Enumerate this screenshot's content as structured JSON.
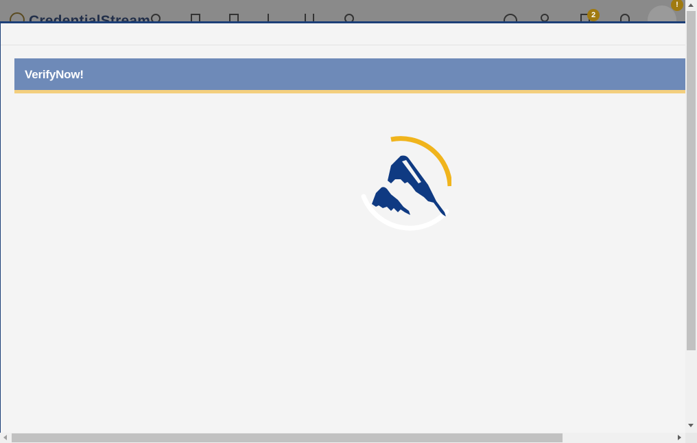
{
  "background_app": {
    "brand": "CredentialStream",
    "notification_count": "2",
    "alert_badge": "!"
  },
  "modal": {
    "title": "VerifyNow!"
  },
  "colors": {
    "header_bar": "#6e8ab8",
    "accent_stripe": "#f3cf7e",
    "spinner_ring": "#f0b41c",
    "logo_blue": "#0f3a82"
  },
  "icons": {
    "loading": "loading-spinner-icon",
    "logo": "verifynow-mountain-logo-icon"
  }
}
